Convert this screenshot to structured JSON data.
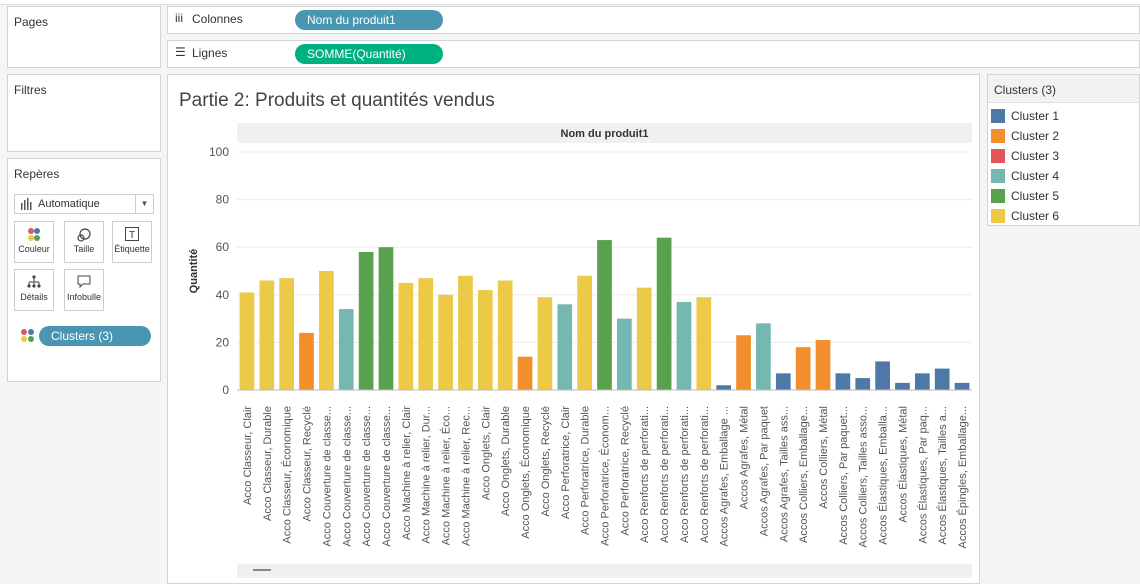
{
  "panels": {
    "pages_title": "Pages",
    "filters_title": "Filtres",
    "marks_title": "Repères"
  },
  "marks": {
    "type": "Automatique",
    "cards": {
      "color": "Couleur",
      "size": "Taille",
      "label": "Étiquette",
      "detail": "Détails",
      "tooltip": "Infobulle"
    },
    "color_pill": "Clusters (3)"
  },
  "shelves": {
    "columns_label": "Colonnes",
    "columns_pill": "Nom du produit1",
    "rows_label": "Lignes",
    "rows_pill": "SOMME(Quantité)"
  },
  "colors": {
    "Cluster 1": "#4e79a7",
    "Cluster 2": "#f28e2b",
    "Cluster 3": "#e15759",
    "Cluster 4": "#76b7b2",
    "Cluster 5": "#59a14f",
    "Cluster 6": "#edc948",
    "pill_blue": "#4996b2",
    "pill_green": "#00b180"
  },
  "legend": {
    "title": "Clusters (3)",
    "items": [
      {
        "label": "Cluster 1",
        "color": "#4e79a7"
      },
      {
        "label": "Cluster 2",
        "color": "#f28e2b"
      },
      {
        "label": "Cluster 3",
        "color": "#e15759"
      },
      {
        "label": "Cluster 4",
        "color": "#76b7b2"
      },
      {
        "label": "Cluster 5",
        "color": "#59a14f"
      },
      {
        "label": "Cluster 6",
        "color": "#edc948"
      }
    ]
  },
  "chart_data": {
    "type": "bar",
    "title": "Partie 2: Produits et quantités vendus",
    "header": "Nom du produit1",
    "xlabel": "",
    "ylabel": "Quantité",
    "ylim": [
      0,
      100
    ],
    "yticks": [
      0,
      20,
      40,
      60,
      80,
      100
    ],
    "grid": true,
    "legend_position": "right",
    "categories": [
      "Acco Classeur, Clair",
      "Acco Classeur, Durable",
      "Acco Classeur, Économique",
      "Acco Classeur, Recyclé",
      "Acco Couverture de classe...",
      "Acco Couverture de classe...",
      "Acco Couverture de classe...",
      "Acco Couverture de classe...",
      "Acco Machine à relier, Clair",
      "Acco Machine à relier, Dur...",
      "Acco Machine à relier, Éco...",
      "Acco Machine à relier, Rec...",
      "Acco Onglets, Clair",
      "Acco Onglets, Durable",
      "Acco Onglets, Économique",
      "Acco Onglets, Recyclé",
      "Acco Perforatrice, Clair",
      "Acco Perforatrice, Durable",
      "Acco Perforatrice, Économ...",
      "Acco Perforatrice, Recyclé",
      "Acco Renforts de perforati...",
      "Acco Renforts de perforati...",
      "Acco Renforts de perforati...",
      "Acco Renforts de perforati...",
      "Accos Agrafes, Emballage ...",
      "Accos Agrafes, Métal",
      "Accos Agrafes, Par paquet",
      "Accos Agrafes, Tailles ass...",
      "Accos Colliers, Emballage...",
      "Accos Colliers, Métal",
      "Accos Colliers, Par paquet...",
      "Accos Colliers, Tailles asso...",
      "Accos Élastiques, Emballa...",
      "Accos Élastiques, Métal",
      "Accos Élastiques, Par paq...",
      "Accos Élastiques, Tailles a...",
      "Accos Épingles, Emballage..."
    ],
    "values": [
      41,
      46,
      47,
      24,
      50,
      34,
      58,
      60,
      45,
      47,
      40,
      48,
      42,
      46,
      14,
      39,
      36,
      48,
      63,
      30,
      43,
      64,
      37,
      39,
      2,
      23,
      28,
      7,
      18,
      21,
      7,
      5,
      12,
      3,
      7,
      9,
      3
    ],
    "clusters": [
      "Cluster 6",
      "Cluster 6",
      "Cluster 6",
      "Cluster 2",
      "Cluster 6",
      "Cluster 4",
      "Cluster 5",
      "Cluster 5",
      "Cluster 6",
      "Cluster 6",
      "Cluster 6",
      "Cluster 6",
      "Cluster 6",
      "Cluster 6",
      "Cluster 2",
      "Cluster 6",
      "Cluster 4",
      "Cluster 6",
      "Cluster 5",
      "Cluster 4",
      "Cluster 6",
      "Cluster 5",
      "Cluster 4",
      "Cluster 6",
      "Cluster 1",
      "Cluster 2",
      "Cluster 4",
      "Cluster 1",
      "Cluster 2",
      "Cluster 2",
      "Cluster 1",
      "Cluster 1",
      "Cluster 1",
      "Cluster 1",
      "Cluster 1",
      "Cluster 1",
      "Cluster 1"
    ]
  }
}
